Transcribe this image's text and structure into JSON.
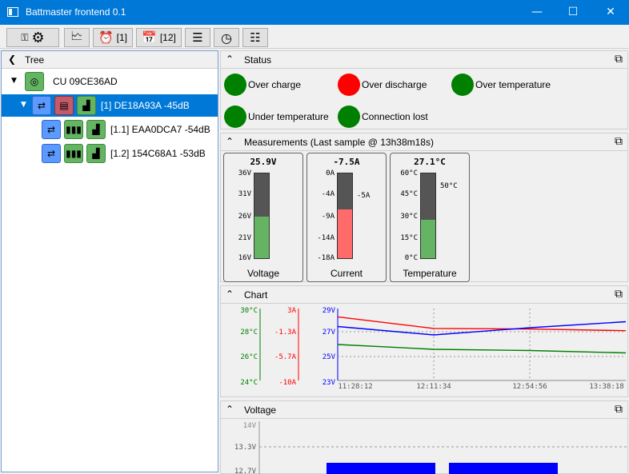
{
  "window": {
    "title": "Battmaster frontend 0.1",
    "minimize": "—",
    "maximize": "☐",
    "close": "✕"
  },
  "toolbar": {
    "alarm_count": "[1]",
    "calendar_count": "[12]"
  },
  "tree": {
    "header": "Tree",
    "nodes": [
      {
        "label": "CU 09CE36AD"
      },
      {
        "label": "[1] DE18A93A -45dB"
      },
      {
        "label": "[1.1] EAA0DCA7 -54dB"
      },
      {
        "label": "[1.2] 154C68A1 -53dB"
      }
    ]
  },
  "status": {
    "header": "Status",
    "items": [
      {
        "label": "Over charge",
        "color": "#008000"
      },
      {
        "label": "Over discharge",
        "color": "#ff0000"
      },
      {
        "label": "Over temperature",
        "color": "#008000"
      },
      {
        "label": "Under temperature",
        "color": "#008000"
      },
      {
        "label": "Connection lost",
        "color": "#008000"
      }
    ]
  },
  "measurements": {
    "header": "Measurements (Last sample @ 13h38m18s)",
    "gauges": [
      {
        "name": "Voltage",
        "value": "25.9V",
        "ticks": [
          "36V",
          "31V",
          "26V",
          "21V",
          "16V"
        ],
        "fill": 0.49,
        "color": "#64b464"
      },
      {
        "name": "Current",
        "value": "-7.5A",
        "ticks": [
          "0A",
          "-4A",
          "-9A",
          "-14A",
          "-18A"
        ],
        "fill": 0.58,
        "color": "#ff6a6a",
        "note": "-5A"
      },
      {
        "name": "Temperature",
        "value": "27.1°C",
        "ticks": [
          "60°C",
          "45°C",
          "30°C",
          "15°C",
          "0°C"
        ],
        "fill": 0.45,
        "color": "#64b464",
        "note": "50°C"
      }
    ]
  },
  "chart": {
    "header": "Chart",
    "temp_ticks": [
      "30°C",
      "28°C",
      "26°C",
      "24°C"
    ],
    "current_ticks": [
      "3A",
      "-1.3A",
      "-5.7A",
      "-10A"
    ],
    "voltage_ticks": [
      "29V",
      "27V",
      "25V",
      "23V"
    ],
    "time_ticks": [
      "11:28:12",
      "12:11:34",
      "12:54:56",
      "13:38:18"
    ],
    "chart_data": {
      "type": "line",
      "x": [
        "11:28:12",
        "12:11:34",
        "12:54:56",
        "13:38:18"
      ],
      "series": [
        {
          "color": "#ff0000",
          "values": [
            1.5,
            -0.6,
            -0.7,
            -1.0
          ]
        },
        {
          "color": "#0000ff",
          "values": [
            27.5,
            26.8,
            27.4,
            27.9
          ]
        },
        {
          "color": "#008000",
          "values": [
            27.0,
            26.6,
            26.5,
            26.3
          ]
        }
      ]
    }
  },
  "voltage": {
    "header": "Voltage",
    "ticks": [
      "14V",
      "13.3V",
      "12.7V"
    ]
  },
  "colors": {
    "accent": "#0078d7",
    "green": "#64b464",
    "red": "#ff0000"
  }
}
